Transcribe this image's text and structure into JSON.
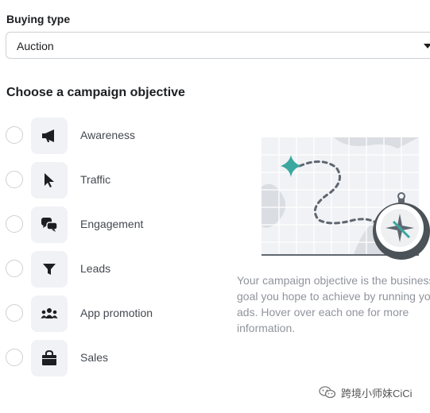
{
  "buying_type": {
    "label": "Buying type",
    "selected": "Auction"
  },
  "objective_section": {
    "heading": "Choose a campaign objective",
    "options": [
      {
        "label": "Awareness",
        "icon": "megaphone-icon"
      },
      {
        "label": "Traffic",
        "icon": "cursor-icon"
      },
      {
        "label": "Engagement",
        "icon": "chat-bubbles-icon"
      },
      {
        "label": "Leads",
        "icon": "funnel-icon"
      },
      {
        "label": "App promotion",
        "icon": "people-icon"
      },
      {
        "label": "Sales",
        "icon": "shopping-bag-icon"
      }
    ]
  },
  "info_panel": {
    "illustration": "map-compass-illustration",
    "description_lines": [
      "Your campaign objective is the business",
      "goal you hope to achieve by running your",
      "ads. Hover over each one for more",
      "information."
    ]
  },
  "watermark": {
    "text": "跨境小师妹CiCi",
    "icon": "wechat-icon"
  },
  "colors": {
    "teal_accent": "#3aa7a0",
    "tile_bg": "#f0f2f5",
    "border": "#ccd0d5"
  }
}
